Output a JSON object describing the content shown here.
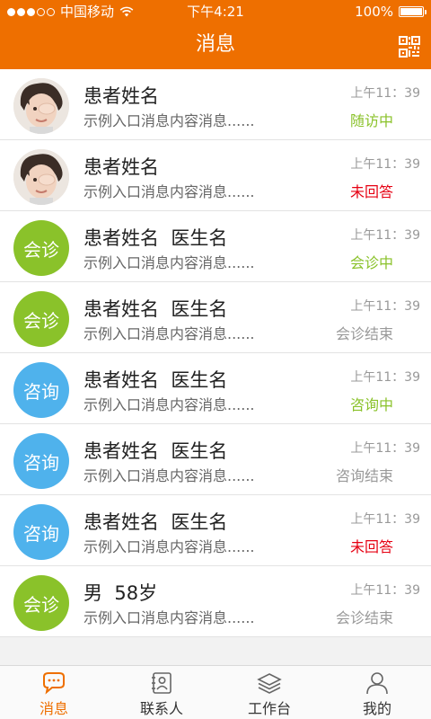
{
  "status_bar": {
    "carrier": "中国移动",
    "time": "下午4:21",
    "battery": "100%"
  },
  "header": {
    "title": "消息",
    "qr_icon": "qr-code-icon"
  },
  "colors": {
    "brand": "#ee6f00",
    "consult_green": "#8ac22a",
    "inquiry_blue": "#4fb2ec",
    "status_green": "#8ac22a",
    "status_red": "#e60012",
    "status_gray": "#999999"
  },
  "messages": [
    {
      "avatar_type": "photo",
      "avatar_text": "",
      "name": "患者姓名",
      "preview": "示例入口消息内容消息......",
      "time": "上午11：39",
      "status": "随访中",
      "status_color": "#8ac22a"
    },
    {
      "avatar_type": "photo",
      "avatar_text": "",
      "name": "患者姓名",
      "preview": "示例入口消息内容消息......",
      "time": "上午11：39",
      "status": "未回答",
      "status_color": "#e60012"
    },
    {
      "avatar_type": "consult",
      "avatar_text": "会诊",
      "name": "患者姓名  医生名",
      "preview": "示例入口消息内容消息......",
      "time": "上午11：39",
      "status": "会诊中",
      "status_color": "#8ac22a"
    },
    {
      "avatar_type": "consult",
      "avatar_text": "会诊",
      "name": "患者姓名  医生名",
      "preview": "示例入口消息内容消息......",
      "time": "上午11：39",
      "status": "会诊结束",
      "status_color": "#999999"
    },
    {
      "avatar_type": "inquiry",
      "avatar_text": "咨询",
      "name": "患者姓名  医生名",
      "preview": "示例入口消息内容消息......",
      "time": "上午11：39",
      "status": "咨询中",
      "status_color": "#8ac22a"
    },
    {
      "avatar_type": "inquiry",
      "avatar_text": "咨询",
      "name": "患者姓名  医生名",
      "preview": "示例入口消息内容消息......",
      "time": "上午11：39",
      "status": "咨询结束",
      "status_color": "#999999"
    },
    {
      "avatar_type": "inquiry",
      "avatar_text": "咨询",
      "name": "患者姓名  医生名",
      "preview": "示例入口消息内容消息......",
      "time": "上午11：39",
      "status": "未回答",
      "status_color": "#e60012"
    },
    {
      "avatar_type": "consult",
      "avatar_text": "会诊",
      "name": "男  58岁",
      "preview": "示例入口消息内容消息......",
      "time": "上午11：39",
      "status": "会诊结束",
      "status_color": "#999999"
    }
  ],
  "tabs": [
    {
      "label": "消息",
      "icon": "chat-bubble-icon",
      "active": true
    },
    {
      "label": "联系人",
      "icon": "contacts-icon",
      "active": false
    },
    {
      "label": "工作台",
      "icon": "layers-icon",
      "active": false
    },
    {
      "label": "我的",
      "icon": "person-icon",
      "active": false
    }
  ]
}
